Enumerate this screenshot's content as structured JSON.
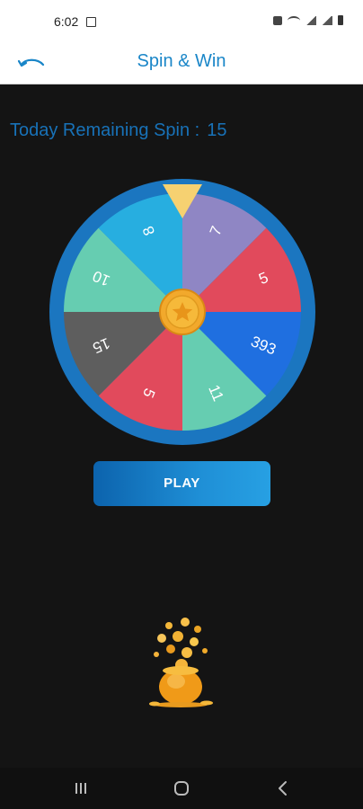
{
  "status": {
    "time": "6:02"
  },
  "app_bar": {
    "title": "Spin & Win"
  },
  "remaining": {
    "label": "Today Remaining Spin :",
    "count": "15"
  },
  "wheel": {
    "segments": [
      {
        "label": "7",
        "color": "#8f86c4"
      },
      {
        "label": "5",
        "color": "#e14a5c"
      },
      {
        "label": "393",
        "color": "#1f6fe0"
      },
      {
        "label": "11",
        "color": "#66cdb1"
      },
      {
        "label": "5",
        "color": "#e14a5c"
      },
      {
        "label": "15",
        "color": "#5e5e5e"
      },
      {
        "label": "10",
        "color": "#66cdb1"
      },
      {
        "label": "8",
        "color": "#27aee0"
      }
    ],
    "rim_color": "#1b76c0",
    "pointer_color": "#f6d171",
    "hub_color": "#f2a92c"
  },
  "play_button": {
    "label": "PLAY"
  }
}
